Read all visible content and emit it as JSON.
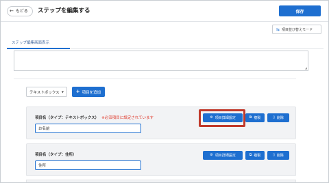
{
  "header": {
    "back_label": "もどる",
    "title": "ステップを編集する",
    "save_label": "保存"
  },
  "toolbar": {
    "reorder_label": "項目並び替えモード"
  },
  "tabs": [
    {
      "label": "ステップ編集画面表示"
    }
  ],
  "add_controls": {
    "type_select_value": "テキストボックス",
    "add_item_label": "項目を追加"
  },
  "items": [
    {
      "label": "項目名（タイプ：テキストボックス）",
      "warning": "※必須項目に設定されています",
      "value": "お名前",
      "detail_label": "項目詳細設定",
      "copy_label": "複製",
      "delete_label": "削除"
    },
    {
      "label": "項目名（タイプ：住所）",
      "warning": "",
      "value": "住所",
      "detail_label": "項目詳細設定",
      "copy_label": "複製",
      "delete_label": "削除"
    }
  ],
  "colors": {
    "primary": "#1e6fd0",
    "warning": "#e0392b",
    "highlight": "#c0392b"
  }
}
